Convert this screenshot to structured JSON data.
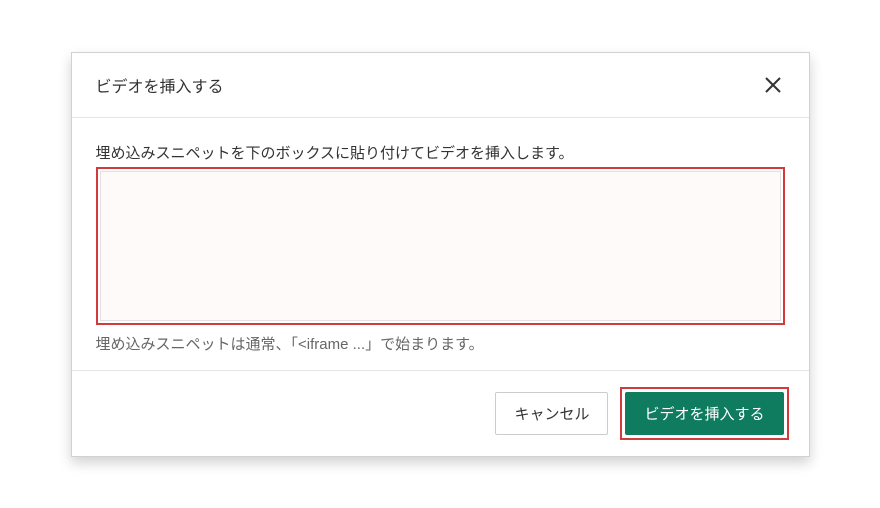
{
  "dialog": {
    "title": "ビデオを挿入する",
    "instruction": "埋め込みスニペットを下のボックスに貼り付けてビデオを挿入します。",
    "textarea_value": "",
    "hint": "埋め込みスニペットは通常、「<iframe ...」で始まります。",
    "cancel_label": "キャンセル",
    "insert_label": "ビデオを挿入する"
  },
  "colors": {
    "primary": "#0f7b5f",
    "highlight": "#d13b3b"
  }
}
